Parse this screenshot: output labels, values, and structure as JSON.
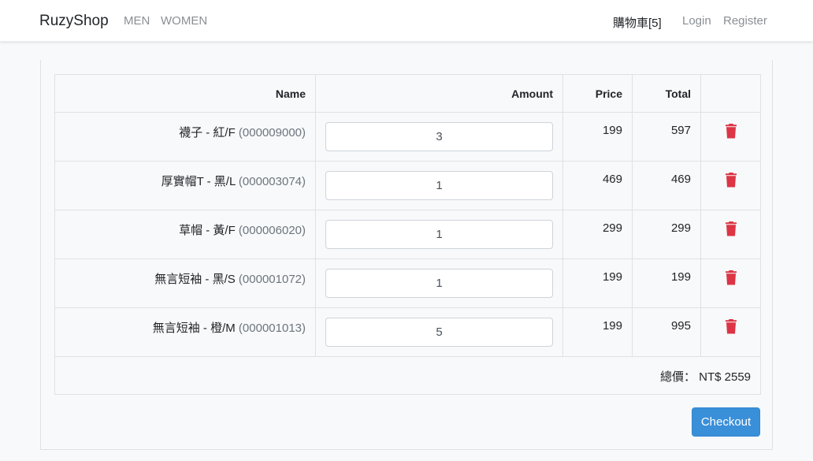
{
  "nav": {
    "brand": "RuzyShop",
    "men": "MEN",
    "women": "WOMEN",
    "cart": "購物車[5]",
    "login": "Login",
    "register": "Register"
  },
  "table": {
    "headers": {
      "name": "Name",
      "amount": "Amount",
      "price": "Price",
      "total": "Total"
    },
    "rows": [
      {
        "name": "襪子 - 紅/F",
        "sku": "(000009000)",
        "amount": "3",
        "price": "199",
        "total": "597"
      },
      {
        "name": "厚實帽T - 黑/L",
        "sku": "(000003074)",
        "amount": "1",
        "price": "469",
        "total": "469"
      },
      {
        "name": "草帽 - 黃/F",
        "sku": "(000006020)",
        "amount": "1",
        "price": "299",
        "total": "299"
      },
      {
        "name": "無言短袖 - 黑/S",
        "sku": "(000001072)",
        "amount": "1",
        "price": "199",
        "total": "199"
      },
      {
        "name": "無言短袖 - 橙/M",
        "sku": "(000001013)",
        "amount": "5",
        "price": "199",
        "total": "995"
      }
    ],
    "grand_total_label": "總價：",
    "grand_total_value": "NT$ 2559"
  },
  "checkout_label": "Checkout",
  "icons": {
    "delete": "trash-icon"
  },
  "colors": {
    "trash": "#dc3545",
    "checkout_bg": "#3a8fd9"
  }
}
